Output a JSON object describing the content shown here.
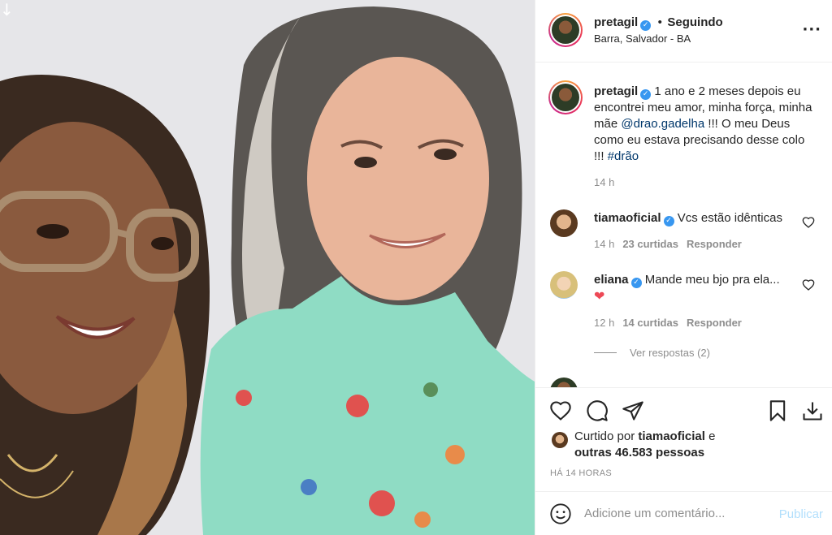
{
  "photo": {
    "description_icon": "download-arrow-icon",
    "arrow_glyph": "↓"
  },
  "header": {
    "username": "pretagil",
    "dot": "•",
    "follow_status": "Seguindo",
    "location": "Barra, Salvador - BA",
    "more_icon": "more-options-icon"
  },
  "caption": {
    "username": "pretagil",
    "text_part1": "1 ano e 2 meses depois eu encontrei meu amor, minha força, minha mãe ",
    "mention": "@drao.gadelha",
    "text_part2": " !!! O meu Deus como eu estava precisando desse colo !!! ",
    "hashtag": "#drão",
    "time": "14 h"
  },
  "comments": [
    {
      "username": "tiamaoficial",
      "text": "Vcs estão idênticas",
      "time": "14 h",
      "likes": "23 curtidas",
      "reply": "Responder"
    },
    {
      "username": "eliana",
      "text": "Mande meu bjo pra ela...",
      "emoji": "❤",
      "time": "12 h",
      "likes": "14 curtidas",
      "reply": "Responder",
      "view_replies": "Ver respostas (2)"
    }
  ],
  "actions": {
    "icons": [
      "heart-icon",
      "comment-icon",
      "share-icon",
      "bookmark-icon",
      "download-icon"
    ],
    "liked_prefix": "Curtido por",
    "liked_user": "tiamaoficial",
    "liked_and": "e",
    "liked_others": "outras 46.583 pessoas",
    "posted_ago": "HÁ 14 HORAS"
  },
  "add_comment": {
    "placeholder": "Adicione um comentário...",
    "publish_label": "Publicar"
  },
  "colors": {
    "link": "#00376b",
    "verified": "#3897f0",
    "muted": "#8e8e8e",
    "publish_disabled": "#b2dffc",
    "heart_red": "#ed4956"
  }
}
